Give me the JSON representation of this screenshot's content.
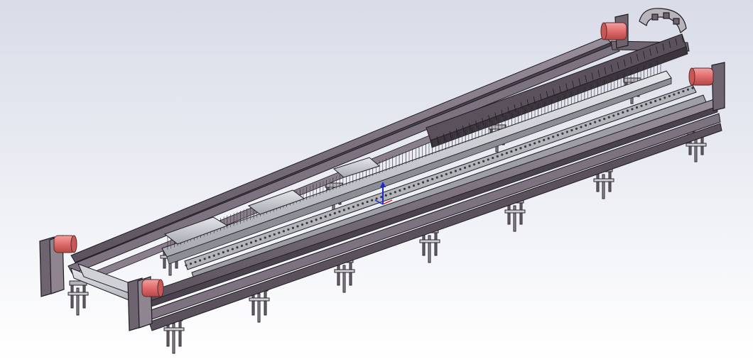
{
  "view": {
    "background_top": "#d9dce8",
    "background_bottom": "#ffffff",
    "frame_color": "#6e6470",
    "frame_light": "#9a8f9c",
    "frame_dark": "#3c353d",
    "edge_color": "#1e1c20",
    "steel_color": "#c9cbd1",
    "motor_color": "#e06b6b",
    "axis_y_color": "#1a2ad8",
    "axis_x_color": "#d81a1a"
  },
  "assembly": {
    "motors": [
      "motor-rear",
      "motor-right",
      "motor-left",
      "motor-front"
    ],
    "icons": [
      "drag-chain-icon",
      "coordinate-triad-icon"
    ]
  }
}
